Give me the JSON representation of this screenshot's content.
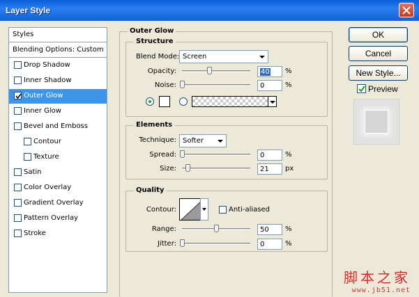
{
  "window": {
    "title": "Layer Style"
  },
  "styles_list": {
    "header": "Styles",
    "blending": "Blending Options: Custom",
    "items": [
      {
        "label": "Drop Shadow",
        "checked": false,
        "selected": false,
        "indent": false
      },
      {
        "label": "Inner Shadow",
        "checked": false,
        "selected": false,
        "indent": false
      },
      {
        "label": "Outer Glow",
        "checked": true,
        "selected": true,
        "indent": false
      },
      {
        "label": "Inner Glow",
        "checked": false,
        "selected": false,
        "indent": false
      },
      {
        "label": "Bevel and Emboss",
        "checked": false,
        "selected": false,
        "indent": false
      },
      {
        "label": "Contour",
        "checked": false,
        "selected": false,
        "indent": true
      },
      {
        "label": "Texture",
        "checked": false,
        "selected": false,
        "indent": true
      },
      {
        "label": "Satin",
        "checked": false,
        "selected": false,
        "indent": false
      },
      {
        "label": "Color Overlay",
        "checked": false,
        "selected": false,
        "indent": false
      },
      {
        "label": "Gradient Overlay",
        "checked": false,
        "selected": false,
        "indent": false
      },
      {
        "label": "Pattern Overlay",
        "checked": false,
        "selected": false,
        "indent": false
      },
      {
        "label": "Stroke",
        "checked": false,
        "selected": false,
        "indent": false
      }
    ]
  },
  "outer_glow": {
    "title": "Outer Glow",
    "structure": {
      "title": "Structure",
      "blend_mode_label": "Blend Mode:",
      "blend_mode_value": "Screen",
      "opacity_label": "Opacity:",
      "opacity_value": "40",
      "opacity_unit": "%",
      "opacity_level": 0.4,
      "noise_label": "Noise:",
      "noise_value": "0",
      "noise_unit": "%",
      "noise_level": 0.0,
      "color_radio_selected": true,
      "gradient_radio_selected": false
    },
    "elements": {
      "title": "Elements",
      "technique_label": "Technique:",
      "technique_value": "Softer",
      "spread_label": "Spread:",
      "spread_value": "0",
      "spread_unit": "%",
      "spread_level": 0.0,
      "size_label": "Size:",
      "size_value": "21",
      "size_unit": "px",
      "size_level": 0.08
    },
    "quality": {
      "title": "Quality",
      "contour_label": "Contour:",
      "anti_aliased_label": "Anti-aliased",
      "anti_aliased_checked": false,
      "range_label": "Range:",
      "range_value": "50",
      "range_unit": "%",
      "range_level": 0.5,
      "jitter_label": "Jitter:",
      "jitter_value": "0",
      "jitter_unit": "%",
      "jitter_level": 0.0
    }
  },
  "buttons": {
    "ok": "OK",
    "cancel": "Cancel",
    "new_style": "New Style...",
    "preview_label": "Preview",
    "preview_checked": true
  },
  "watermark": {
    "chinese": "脚本之家",
    "url": "www.jb51.net"
  },
  "colors": {
    "selection": "#3d95e8",
    "title_bar": "#0a5fd8",
    "glow_color": "#ffffff"
  }
}
